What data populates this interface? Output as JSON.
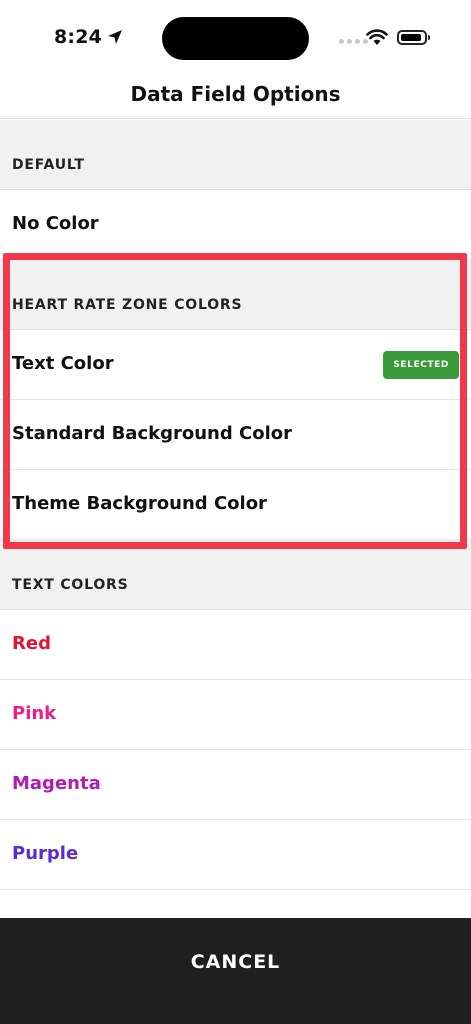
{
  "status_bar": {
    "time": "8:24"
  },
  "nav": {
    "title": "Data Field Options"
  },
  "sections": [
    {
      "header": "DEFAULT",
      "rows": [
        {
          "label": "No Color",
          "color": "#111111"
        }
      ]
    },
    {
      "header": "HEART RATE ZONE COLORS",
      "rows": [
        {
          "label": "Text Color",
          "color": "#111111",
          "badge": "SELECTED"
        },
        {
          "label": "Standard Background Color",
          "color": "#111111"
        },
        {
          "label": "Theme Background Color",
          "color": "#111111"
        }
      ]
    },
    {
      "header": "TEXT COLORS",
      "rows": [
        {
          "label": "Red",
          "color": "#e0142c"
        },
        {
          "label": "Pink",
          "color": "#e81f8c"
        },
        {
          "label": "Magenta",
          "color": "#b11bb5"
        },
        {
          "label": "Purple",
          "color": "#5b2bd1"
        }
      ]
    }
  ],
  "footer": {
    "cancel_label": "CANCEL"
  },
  "colors": {
    "highlight_border": "#f2384b",
    "selected_badge": "#3a9a3a",
    "footer_bg": "#1f1f1f"
  },
  "icons": {
    "location": "location-arrow-icon",
    "wifi": "wifi-icon",
    "battery": "battery-icon",
    "signal": "cellular-signal-icon"
  }
}
